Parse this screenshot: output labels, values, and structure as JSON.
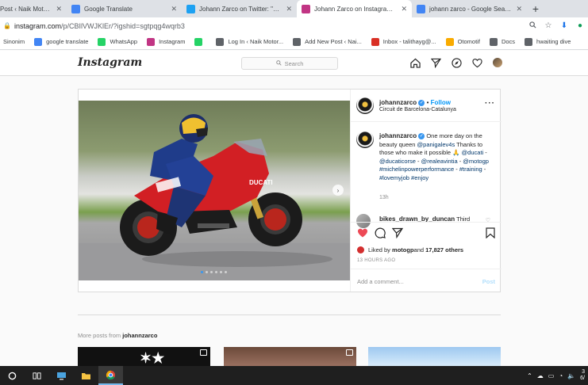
{
  "browser": {
    "tabs": [
      {
        "label": "Post ‹ Naik Motor | J",
        "favicon": "wordpress-icon",
        "color": "#21759b",
        "active": false
      },
      {
        "label": "Google Translate",
        "favicon": "google-translate-icon",
        "color": "#4285f4",
        "active": false
      },
      {
        "label": "Johann Zarco on Twitter: \"One",
        "favicon": "twitter-icon",
        "color": "#1da1f2",
        "active": false
      },
      {
        "label": "Johann Zarco on Instagram: \"C",
        "favicon": "instagram-icon",
        "color": "#c13584",
        "active": true
      },
      {
        "label": "johann zarco - Google Search",
        "favicon": "google-icon",
        "color": "#4285f4",
        "active": false
      }
    ],
    "new_tab_label": "+",
    "url_host": "instagram.com",
    "url_path": "/p/CBIlVWJKlEr/?igshid=sgtpqg4wqrb3",
    "bookmarks": [
      {
        "label": "Sinonim",
        "icon": "none",
        "color": ""
      },
      {
        "label": "google translate",
        "icon": "google-translate-icon",
        "color": "#4285f4"
      },
      {
        "label": "WhatsApp",
        "icon": "whatsapp-icon",
        "color": "#25d366"
      },
      {
        "label": "Instagram",
        "icon": "instagram-icon",
        "color": "#c13584"
      },
      {
        "label": "",
        "icon": "whatsapp-icon",
        "color": "#25d366"
      },
      {
        "label": "Log In ‹ Naik Motor...",
        "icon": "globe-icon",
        "color": "#5f6368"
      },
      {
        "label": "Add New Post ‹ Nai...",
        "icon": "globe-icon",
        "color": "#5f6368"
      },
      {
        "label": "Inbox - talithayg@...",
        "icon": "gmail-icon",
        "color": "#d93025"
      },
      {
        "label": "Otomotif",
        "icon": "folder-icon",
        "color": "#f9ab00"
      },
      {
        "label": "Docs",
        "icon": "globe-icon",
        "color": "#5f6368"
      },
      {
        "label": "hwaiting dive",
        "icon": "globe-icon",
        "color": "#5f6368"
      }
    ]
  },
  "instagram": {
    "logo_text": "Instagram",
    "search_placeholder": "Search",
    "post": {
      "username": "johannzarco",
      "follow_label": "Follow",
      "separator": "•",
      "location": "Circuit de Barcelona-Catalunya",
      "caption_segments": [
        {
          "text": "One more day on the beauty queen ",
          "link": false
        },
        {
          "text": "@panigalev4s",
          "link": true
        },
        {
          "text": " Thanks to those who make it possible 🙏 ",
          "link": false
        },
        {
          "text": "@ducati",
          "link": true
        },
        {
          "text": " - ",
          "link": false
        },
        {
          "text": "@ducaticorse",
          "link": true
        },
        {
          "text": " - ",
          "link": false
        },
        {
          "text": "@realeavintia",
          "link": true
        },
        {
          "text": " - ",
          "link": false
        },
        {
          "text": "@motogp",
          "link": true
        },
        {
          "text": " ",
          "link": false
        },
        {
          "text": "#michelinpowerperformance",
          "link": true
        },
        {
          "text": " - ",
          "link": false
        },
        {
          "text": "#training",
          "link": true
        },
        {
          "text": " - ",
          "link": false
        },
        {
          "text": "#lovemyjob",
          "link": true
        },
        {
          "text": " ",
          "link": false
        },
        {
          "text": "#enjoy",
          "link": true
        }
      ],
      "caption_time": "13h",
      "comment_user": "bikes_drawn_by_duncan",
      "comment_text": "Third",
      "liked_by_prefix": "Liked by ",
      "liked_by_user": "motogp",
      "liked_by_and": " and ",
      "liked_by_count": "17,827 others",
      "posted_ago": "13 HOURS AGO",
      "comment_placeholder": "Add a comment...",
      "post_button": "Post",
      "carousel_count": 6,
      "carousel_index": 0
    },
    "more_posts_prefix": "More posts from ",
    "more_posts_user": "johannzarco"
  },
  "taskbar": {
    "clock_time": "3",
    "clock_date": "6/"
  }
}
